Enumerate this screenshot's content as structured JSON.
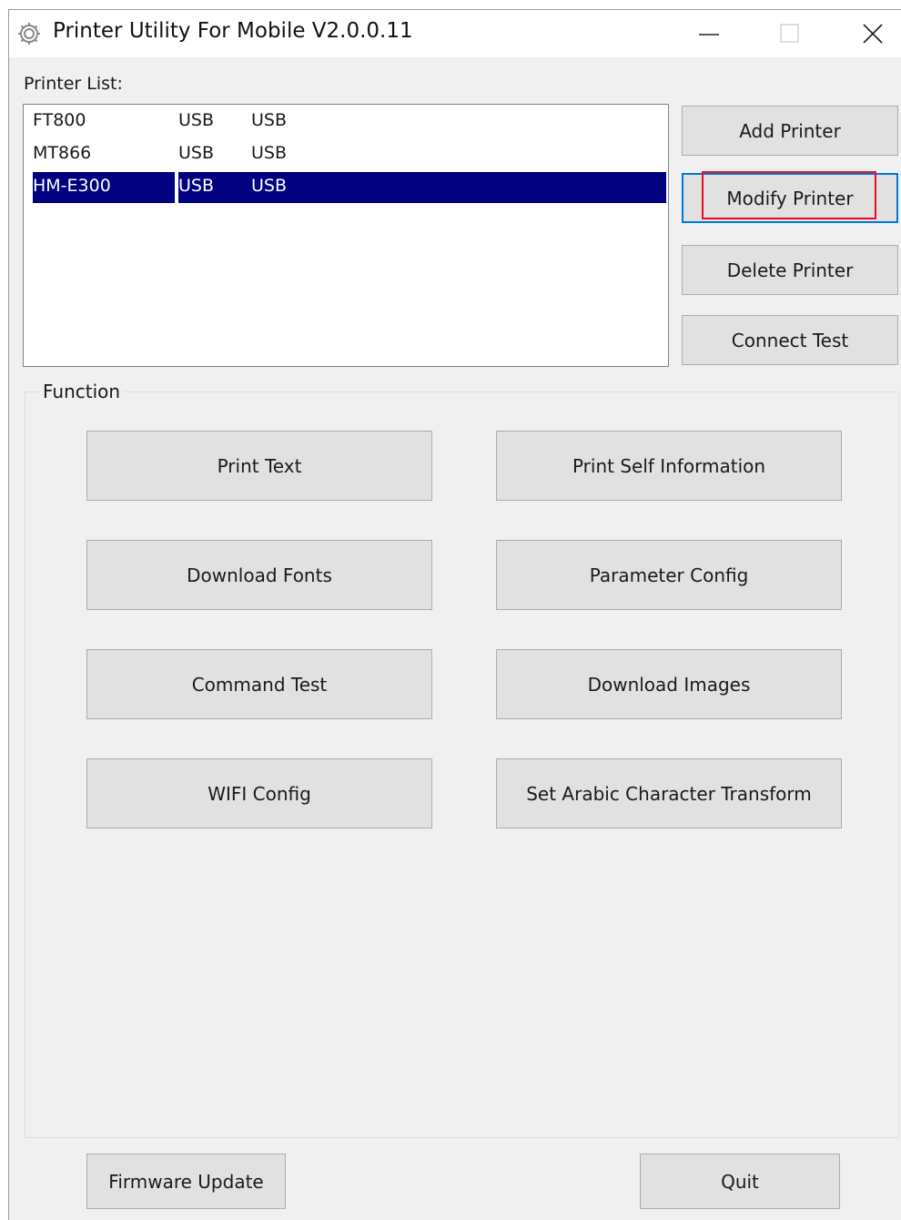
{
  "window": {
    "title": "Printer Utility For Mobile  V2.0.0.11",
    "icon": "gear-icon",
    "controls": [
      "minimize-icon",
      "maximize-icon",
      "close-icon"
    ]
  },
  "printer_list": {
    "label": "Printer List:",
    "rows": [
      {
        "name": "FT800",
        "port": "USB",
        "type": "USB",
        "selected": false
      },
      {
        "name": "MT866",
        "port": "USB",
        "type": "USB",
        "selected": false
      },
      {
        "name": "HM-E300",
        "port": "USB",
        "type": "USB",
        "selected": true
      }
    ],
    "selection_color": "#000080"
  },
  "side_buttons": {
    "add": "Add Printer",
    "modify": "Modify Printer",
    "delete": "Delete Printer",
    "connect": "Connect Test"
  },
  "function_group": {
    "title": "Function",
    "print_text": "Print Text",
    "print_self": "Print Self Information",
    "download_fonts": "Download Fonts",
    "parameter_config": "Parameter Config",
    "command_test": "Command Test",
    "download_images": "Download Images",
    "wifi_config": "WIFI Config",
    "arabic": "Set Arabic Character Transform"
  },
  "footer": {
    "firmware": "Firmware Update",
    "quit": "Quit"
  },
  "colors": {
    "focus_border": "#0078d7",
    "highlight_box": "#e81123"
  }
}
